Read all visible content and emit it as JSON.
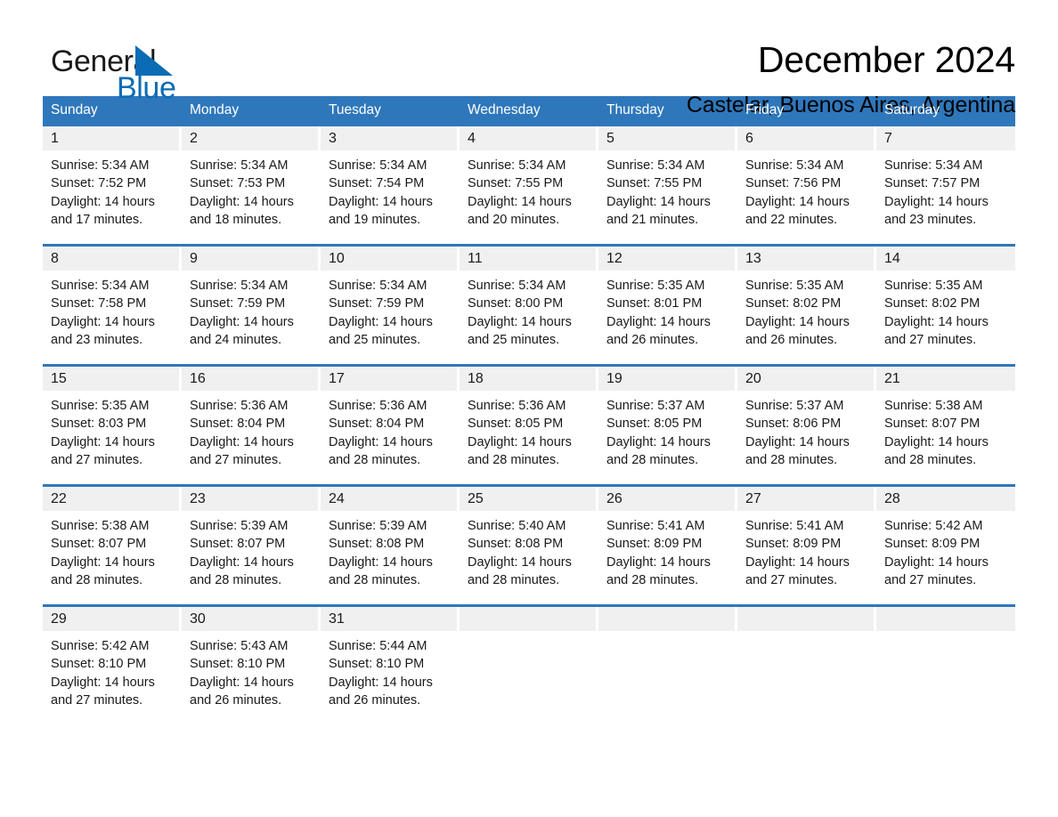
{
  "brand": {
    "name_part1": "General",
    "name_part2": "Blue",
    "triangle_color": "#0a6cb4",
    "accent_color": "#2f77bb"
  },
  "header": {
    "title": "December 2024",
    "subtitle": "Castelar, Buenos Aires, Argentina"
  },
  "weekdays": [
    "Sunday",
    "Monday",
    "Tuesday",
    "Wednesday",
    "Thursday",
    "Friday",
    "Saturday"
  ],
  "weeks": [
    [
      {
        "day": "1",
        "sunrise": "Sunrise: 5:34 AM",
        "sunset": "Sunset: 7:52 PM",
        "daylight": "Daylight: 14 hours and 17 minutes."
      },
      {
        "day": "2",
        "sunrise": "Sunrise: 5:34 AM",
        "sunset": "Sunset: 7:53 PM",
        "daylight": "Daylight: 14 hours and 18 minutes."
      },
      {
        "day": "3",
        "sunrise": "Sunrise: 5:34 AM",
        "sunset": "Sunset: 7:54 PM",
        "daylight": "Daylight: 14 hours and 19 minutes."
      },
      {
        "day": "4",
        "sunrise": "Sunrise: 5:34 AM",
        "sunset": "Sunset: 7:55 PM",
        "daylight": "Daylight: 14 hours and 20 minutes."
      },
      {
        "day": "5",
        "sunrise": "Sunrise: 5:34 AM",
        "sunset": "Sunset: 7:55 PM",
        "daylight": "Daylight: 14 hours and 21 minutes."
      },
      {
        "day": "6",
        "sunrise": "Sunrise: 5:34 AM",
        "sunset": "Sunset: 7:56 PM",
        "daylight": "Daylight: 14 hours and 22 minutes."
      },
      {
        "day": "7",
        "sunrise": "Sunrise: 5:34 AM",
        "sunset": "Sunset: 7:57 PM",
        "daylight": "Daylight: 14 hours and 23 minutes."
      }
    ],
    [
      {
        "day": "8",
        "sunrise": "Sunrise: 5:34 AM",
        "sunset": "Sunset: 7:58 PM",
        "daylight": "Daylight: 14 hours and 23 minutes."
      },
      {
        "day": "9",
        "sunrise": "Sunrise: 5:34 AM",
        "sunset": "Sunset: 7:59 PM",
        "daylight": "Daylight: 14 hours and 24 minutes."
      },
      {
        "day": "10",
        "sunrise": "Sunrise: 5:34 AM",
        "sunset": "Sunset: 7:59 PM",
        "daylight": "Daylight: 14 hours and 25 minutes."
      },
      {
        "day": "11",
        "sunrise": "Sunrise: 5:34 AM",
        "sunset": "Sunset: 8:00 PM",
        "daylight": "Daylight: 14 hours and 25 minutes."
      },
      {
        "day": "12",
        "sunrise": "Sunrise: 5:35 AM",
        "sunset": "Sunset: 8:01 PM",
        "daylight": "Daylight: 14 hours and 26 minutes."
      },
      {
        "day": "13",
        "sunrise": "Sunrise: 5:35 AM",
        "sunset": "Sunset: 8:02 PM",
        "daylight": "Daylight: 14 hours and 26 minutes."
      },
      {
        "day": "14",
        "sunrise": "Sunrise: 5:35 AM",
        "sunset": "Sunset: 8:02 PM",
        "daylight": "Daylight: 14 hours and 27 minutes."
      }
    ],
    [
      {
        "day": "15",
        "sunrise": "Sunrise: 5:35 AM",
        "sunset": "Sunset: 8:03 PM",
        "daylight": "Daylight: 14 hours and 27 minutes."
      },
      {
        "day": "16",
        "sunrise": "Sunrise: 5:36 AM",
        "sunset": "Sunset: 8:04 PM",
        "daylight": "Daylight: 14 hours and 27 minutes."
      },
      {
        "day": "17",
        "sunrise": "Sunrise: 5:36 AM",
        "sunset": "Sunset: 8:04 PM",
        "daylight": "Daylight: 14 hours and 28 minutes."
      },
      {
        "day": "18",
        "sunrise": "Sunrise: 5:36 AM",
        "sunset": "Sunset: 8:05 PM",
        "daylight": "Daylight: 14 hours and 28 minutes."
      },
      {
        "day": "19",
        "sunrise": "Sunrise: 5:37 AM",
        "sunset": "Sunset: 8:05 PM",
        "daylight": "Daylight: 14 hours and 28 minutes."
      },
      {
        "day": "20",
        "sunrise": "Sunrise: 5:37 AM",
        "sunset": "Sunset: 8:06 PM",
        "daylight": "Daylight: 14 hours and 28 minutes."
      },
      {
        "day": "21",
        "sunrise": "Sunrise: 5:38 AM",
        "sunset": "Sunset: 8:07 PM",
        "daylight": "Daylight: 14 hours and 28 minutes."
      }
    ],
    [
      {
        "day": "22",
        "sunrise": "Sunrise: 5:38 AM",
        "sunset": "Sunset: 8:07 PM",
        "daylight": "Daylight: 14 hours and 28 minutes."
      },
      {
        "day": "23",
        "sunrise": "Sunrise: 5:39 AM",
        "sunset": "Sunset: 8:07 PM",
        "daylight": "Daylight: 14 hours and 28 minutes."
      },
      {
        "day": "24",
        "sunrise": "Sunrise: 5:39 AM",
        "sunset": "Sunset: 8:08 PM",
        "daylight": "Daylight: 14 hours and 28 minutes."
      },
      {
        "day": "25",
        "sunrise": "Sunrise: 5:40 AM",
        "sunset": "Sunset: 8:08 PM",
        "daylight": "Daylight: 14 hours and 28 minutes."
      },
      {
        "day": "26",
        "sunrise": "Sunrise: 5:41 AM",
        "sunset": "Sunset: 8:09 PM",
        "daylight": "Daylight: 14 hours and 28 minutes."
      },
      {
        "day": "27",
        "sunrise": "Sunrise: 5:41 AM",
        "sunset": "Sunset: 8:09 PM",
        "daylight": "Daylight: 14 hours and 27 minutes."
      },
      {
        "day": "28",
        "sunrise": "Sunrise: 5:42 AM",
        "sunset": "Sunset: 8:09 PM",
        "daylight": "Daylight: 14 hours and 27 minutes."
      }
    ],
    [
      {
        "day": "29",
        "sunrise": "Sunrise: 5:42 AM",
        "sunset": "Sunset: 8:10 PM",
        "daylight": "Daylight: 14 hours and 27 minutes."
      },
      {
        "day": "30",
        "sunrise": "Sunrise: 5:43 AM",
        "sunset": "Sunset: 8:10 PM",
        "daylight": "Daylight: 14 hours and 26 minutes."
      },
      {
        "day": "31",
        "sunrise": "Sunrise: 5:44 AM",
        "sunset": "Sunset: 8:10 PM",
        "daylight": "Daylight: 14 hours and 26 minutes."
      },
      {
        "day": "",
        "sunrise": "",
        "sunset": "",
        "daylight": ""
      },
      {
        "day": "",
        "sunrise": "",
        "sunset": "",
        "daylight": ""
      },
      {
        "day": "",
        "sunrise": "",
        "sunset": "",
        "daylight": ""
      },
      {
        "day": "",
        "sunrise": "",
        "sunset": "",
        "daylight": ""
      }
    ]
  ]
}
